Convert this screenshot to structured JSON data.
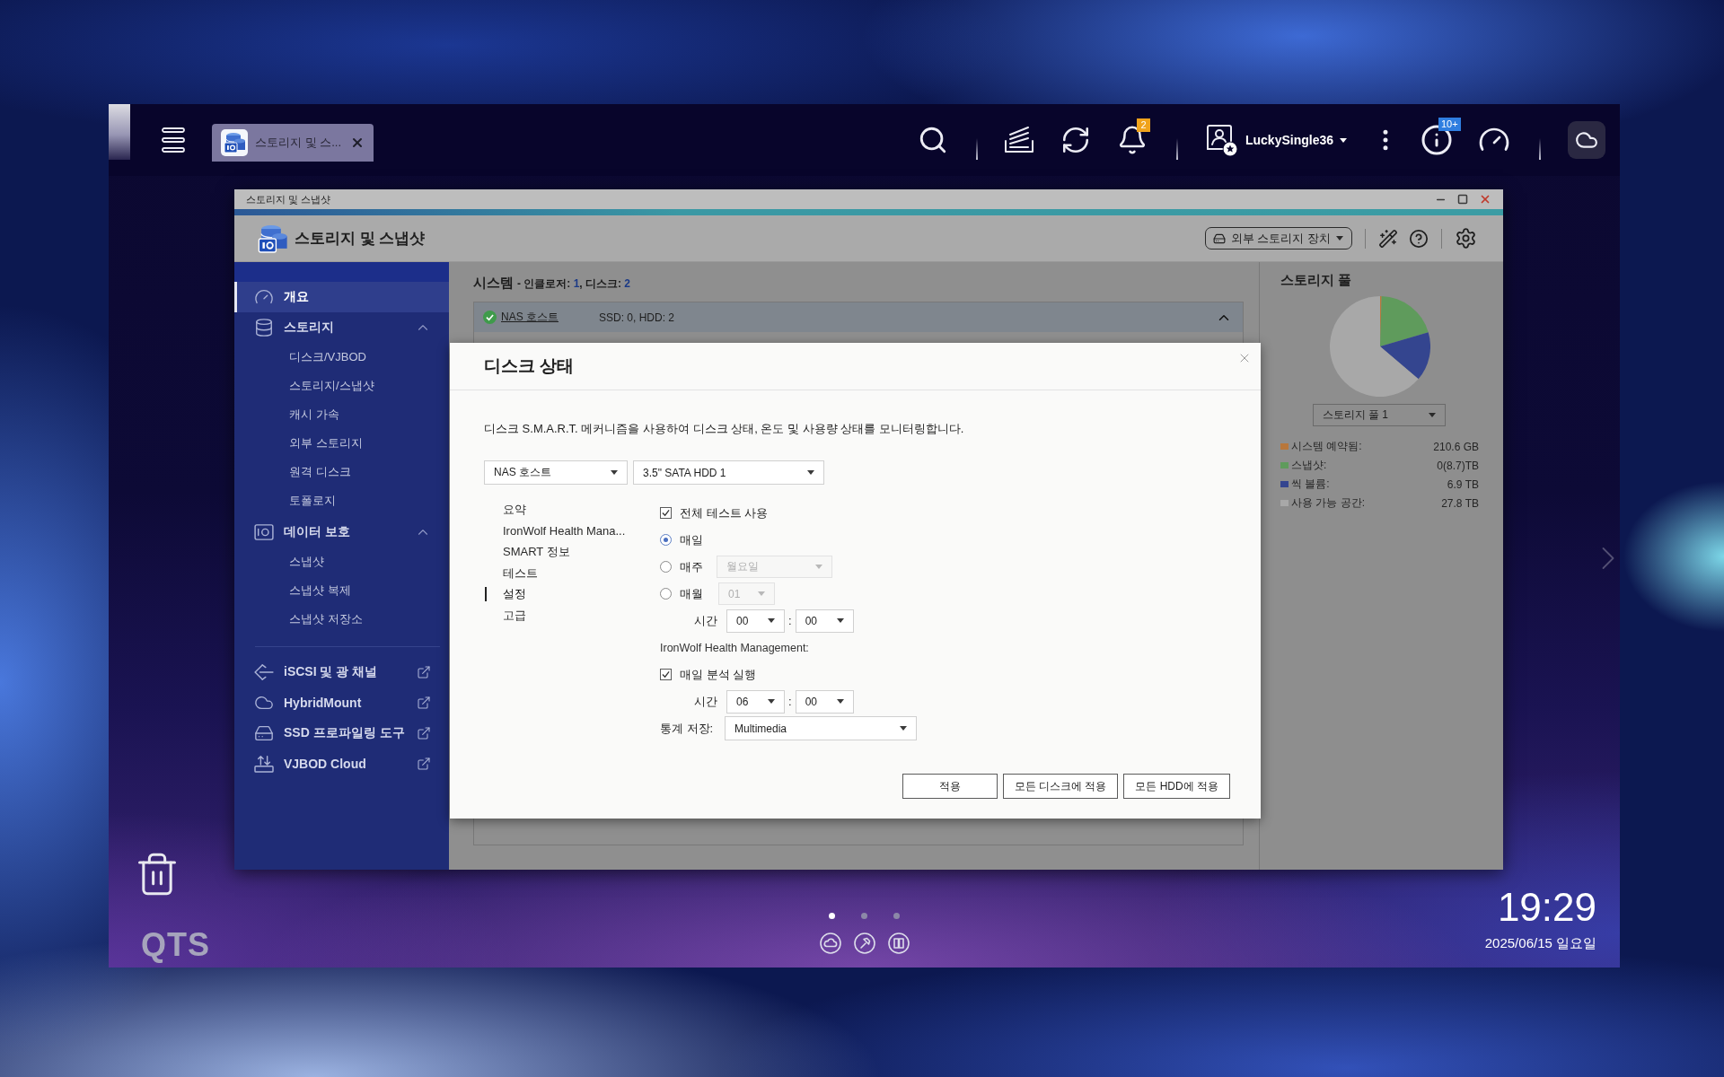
{
  "topbar": {
    "tabs": [
      {
        "label": "스토리지 및 스...",
        "selected": true
      }
    ],
    "notifications": "2",
    "user": "LuckySingle36",
    "alerts": "10+"
  },
  "window": {
    "title": "스토리지 및 스냅샷",
    "heading": "스토리지 및 스냅샷",
    "external_storage_button": "외부 스토리지 장치"
  },
  "sidebar": {
    "items": [
      {
        "kind": "item",
        "label": "개요",
        "selected": true
      },
      {
        "kind": "group",
        "label": "스토리지",
        "selected": false,
        "expanded": true,
        "children": [
          {
            "label": "디스크/VJBOD",
            "selected": false
          },
          {
            "label": "스토리지/스냅샷",
            "selected": false
          },
          {
            "label": "캐시 가속",
            "selected": false
          },
          {
            "label": "외부 스토리지",
            "selected": false
          },
          {
            "label": "원격 디스크",
            "selected": false
          },
          {
            "label": "토폴로지",
            "selected": false
          }
        ]
      },
      {
        "kind": "group",
        "label": "데이터 보호",
        "selected": false,
        "expanded": true,
        "children": [
          {
            "label": "스냅샷",
            "selected": false
          },
          {
            "label": "스냅샷 복제",
            "selected": false
          },
          {
            "label": "스냅샷 저장소",
            "selected": false
          }
        ]
      },
      {
        "kind": "link",
        "label": "iSCSI 및 광 채널",
        "selected": false
      },
      {
        "kind": "link",
        "label": "HybridMount",
        "selected": false
      },
      {
        "kind": "link",
        "label": "SSD 프로파일링 도구",
        "selected": false
      },
      {
        "kind": "link",
        "label": "VJBOD Cloud",
        "selected": false
      }
    ]
  },
  "system": {
    "title": "시스템",
    "summary": [
      {
        "kind": "label",
        "text": "- 인클로저: "
      },
      {
        "kind": "value",
        "text": "1"
      },
      {
        "kind": "label",
        "text": ", 디스크: "
      },
      {
        "kind": "value",
        "text": "2"
      }
    ],
    "host": {
      "name": "NAS 호스트",
      "healthy": true,
      "disks": "SSD: 0, HDD: 2",
      "expanded": true
    }
  },
  "dialog": {
    "title": "디스크 상태",
    "description": "디스크 S.M.A.R.T. 메커니즘을 사용하여 디스크 상태, 온도 및 사용량 상태를 모니터링합니다.",
    "selectors": [
      "NAS 호스트",
      "3.5\" SATA HDD 1"
    ],
    "nav": [
      {
        "label": "요약",
        "selected": false
      },
      {
        "label": "IronWolf Health Mana...",
        "selected": false
      },
      {
        "label": "SMART 정보",
        "selected": false
      },
      {
        "label": "테스트",
        "selected": false
      },
      {
        "label": "설정",
        "selected": true
      },
      {
        "label": "고급",
        "selected": false
      }
    ],
    "full_test": {
      "label": "전체 테스트 사용",
      "checked": true
    },
    "schedule": [
      {
        "label": "매일",
        "selected": true
      },
      {
        "label": "매주",
        "selected": false,
        "select": {
          "value": "월요일",
          "disabled": true
        }
      },
      {
        "label": "매월",
        "selected": false,
        "select": {
          "value": "01",
          "disabled": true
        }
      }
    ],
    "test_time": {
      "label": "시간",
      "hour": "00",
      "separator": ":",
      "minute": "00"
    },
    "ironwolf_heading": "IronWolf Health Management:",
    "daily_analysis": {
      "label": "매일 분석 실행",
      "checked": true
    },
    "analysis_time": {
      "label": "시간",
      "hour": "06",
      "separator": ":",
      "minute": "00"
    },
    "stats_storage": {
      "label": "통계 저장:",
      "value": "Multimedia"
    },
    "buttons": [
      "적용",
      "모든 디스크에 적용",
      "모든 HDD에 적용"
    ]
  },
  "storage_pool": {
    "title": "스토리지 풀",
    "chart_data": {
      "type": "pie",
      "values": [
        0.48,
        19.95,
        15.82,
        63.75
      ]
    },
    "selector": "스토리지 풀 1",
    "legend": [
      {
        "label": "시스템 예약됨:",
        "value": "210.6 GB",
        "color": "#b8773c"
      },
      {
        "label": "스냅샷:",
        "value": "0(8.7)TB",
        "color": "#5f9b5c"
      },
      {
        "label": "씩 볼륨:",
        "value": "6.9 TB",
        "color": "#34458f"
      },
      {
        "label": "사용 가능 공간:",
        "value": "27.8 TB",
        "color": "#a8a8a8"
      }
    ]
  },
  "desktop": {
    "brand": "QTS",
    "clock": "19:29",
    "date": "2025/06/15 일요일",
    "page_dots": [
      {
        "selected": true
      },
      {
        "selected": false
      },
      {
        "selected": false
      }
    ]
  }
}
